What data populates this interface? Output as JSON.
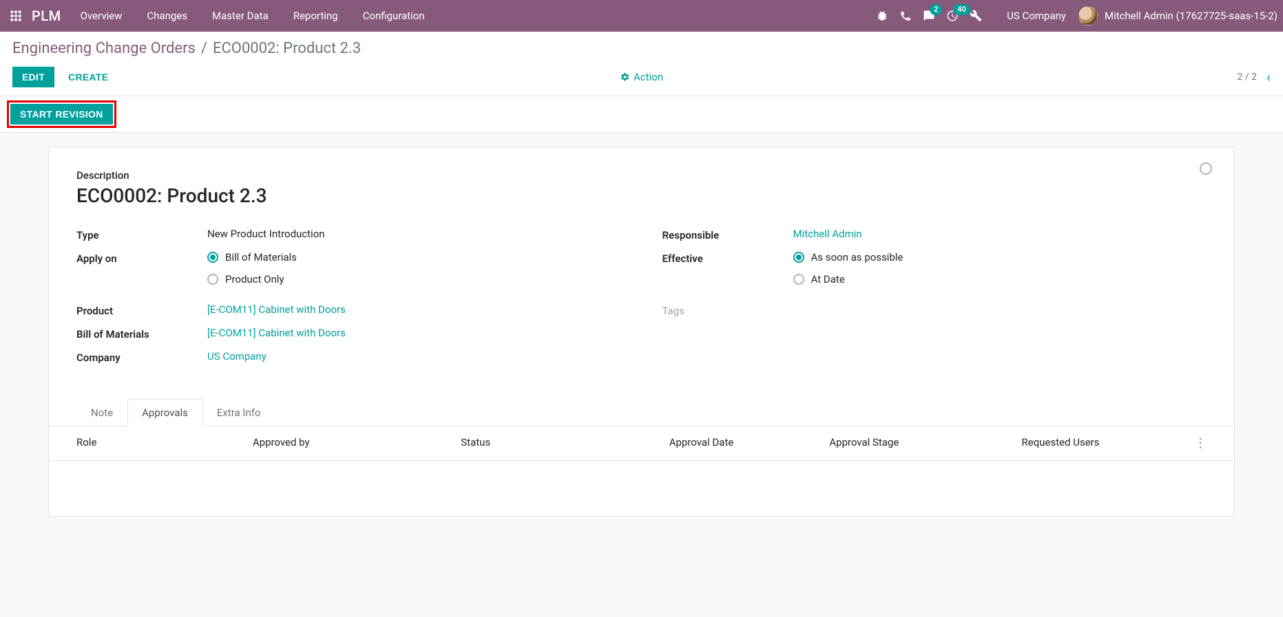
{
  "topnav": {
    "brand": "PLM",
    "menu": [
      "Overview",
      "Changes",
      "Master Data",
      "Reporting",
      "Configuration"
    ],
    "badges": {
      "conversations": "2",
      "activities": "40"
    },
    "company": "US Company",
    "user": "Mitchell Admin (17627725-saas-15-2)"
  },
  "breadcrumbs": {
    "parent": "Engineering Change Orders",
    "current": "ECO0002: Product 2.3"
  },
  "controls": {
    "edit": "Edit",
    "create": "Create",
    "action": "Action",
    "pager": "2 / 2"
  },
  "statusbar": {
    "start_revision": "Start Revision"
  },
  "form": {
    "title_label": "Description",
    "title_value": "ECO0002: Product 2.3",
    "left": {
      "type_label": "Type",
      "type_value": "New Product Introduction",
      "apply_on_label": "Apply on",
      "apply_on_options": [
        "Bill of Materials",
        "Product Only"
      ],
      "product_label": "Product",
      "product_value": "[E-COM11] Cabinet with Doors",
      "bom_label": "Bill of Materials",
      "bom_value": "[E-COM11] Cabinet with Doors",
      "company_label": "Company",
      "company_value": "US Company"
    },
    "right": {
      "responsible_label": "Responsible",
      "responsible_value": "Mitchell Admin",
      "effective_label": "Effective",
      "effective_options": [
        "As soon as possible",
        "At Date"
      ],
      "tags_label": "Tags"
    }
  },
  "tabs": {
    "items": [
      "Note",
      "Approvals",
      "Extra Info"
    ],
    "approvals_columns": [
      "Role",
      "Approved by",
      "Status",
      "Approval Date",
      "Approval Stage",
      "Requested Users"
    ]
  }
}
